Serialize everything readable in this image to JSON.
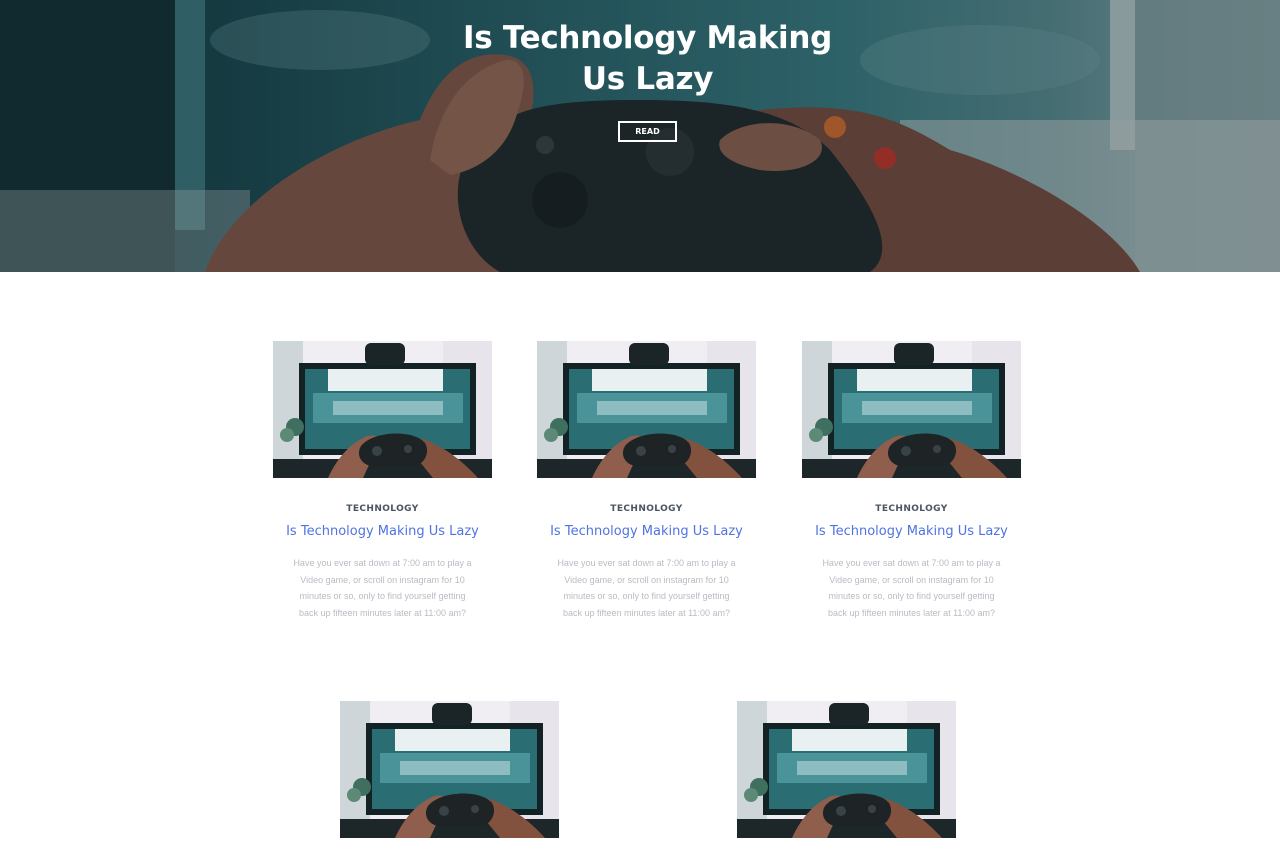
{
  "hero": {
    "title": "Is Technology Making Us Lazy",
    "button_label": "READ",
    "image_icon": "gamepad-hands-photo"
  },
  "posts": [
    {
      "category": "TECHNOLOGY",
      "title": "Is Technology Making Us Lazy",
      "excerpt": "Have you ever sat down at 7:00 am to play a Video game, or scroll on instagram for 10 minutes or so, only to find yourself getting back up fifteen minutes later at 11:00 am?",
      "image_icon": "gaming-monitor-photo"
    },
    {
      "category": "TECHNOLOGY",
      "title": "Is Technology Making Us Lazy",
      "excerpt": "Have you ever sat down at 7:00 am to play a Video game, or scroll on instagram for 10 minutes or so, only to find yourself getting back up fifteen minutes later at 11:00 am?",
      "image_icon": "gaming-monitor-photo"
    },
    {
      "category": "TECHNOLOGY",
      "title": "Is Technology Making Us Lazy",
      "excerpt": "Have you ever sat down at 7:00 am to play a Video game, or scroll on instagram for 10 minutes or so, only to find yourself getting back up fifteen minutes later at 11:00 am?",
      "image_icon": "gaming-monitor-photo"
    },
    {
      "image_icon": "gaming-monitor-photo"
    },
    {
      "image_icon": "gaming-monitor-photo"
    }
  ],
  "colors": {
    "accent_title": "#4f73e3",
    "category_text": "#4a5563",
    "excerpt_text": "#b7bcc3",
    "hero_teal": "#2d6a72"
  }
}
